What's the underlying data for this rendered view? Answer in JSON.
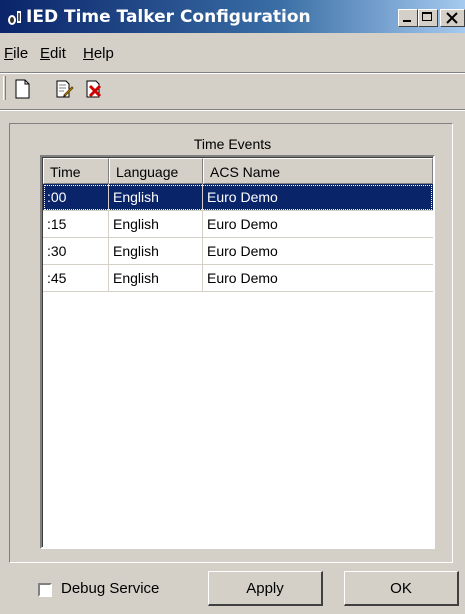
{
  "window": {
    "title": "IED Time Talker Configuration"
  },
  "menu": {
    "file": "File",
    "edit": "Edit",
    "help": "Help"
  },
  "toolbar": {
    "icons": [
      "new-document-icon",
      "edit-document-icon",
      "delete-icon"
    ]
  },
  "group": {
    "title": "Time Events"
  },
  "table": {
    "columns": [
      "Time",
      "Language",
      "ACS Name"
    ],
    "rows": [
      {
        "time": ":00",
        "language": "English",
        "acs": "Euro Demo",
        "selected": true
      },
      {
        "time": ":15",
        "language": "English",
        "acs": "Euro Demo",
        "selected": false
      },
      {
        "time": ":30",
        "language": "English",
        "acs": "Euro Demo",
        "selected": false
      },
      {
        "time": ":45",
        "language": "English",
        "acs": "Euro Demo",
        "selected": false
      }
    ]
  },
  "footer": {
    "debug_label": "Debug Service",
    "debug_checked": false,
    "apply_label": "Apply",
    "ok_label": "OK"
  },
  "colors": {
    "titlebar": "#0a246a",
    "selection": "#0a246a",
    "face": "#d4d0c8"
  }
}
